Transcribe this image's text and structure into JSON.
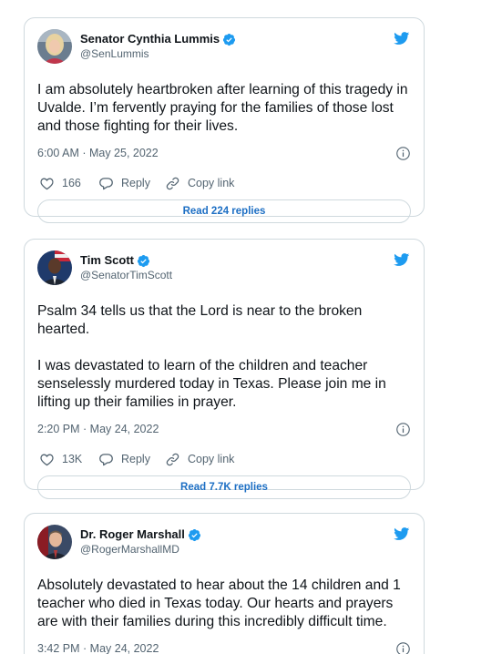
{
  "colors": {
    "twitter_blue": "#1d9bf0",
    "text": "#0f1419",
    "secondary": "#536471",
    "link": "#1d6fc4",
    "border": "#cfd9de"
  },
  "tweets": [
    {
      "name": "Senator Cynthia Lummis",
      "handle": "@SenLummis",
      "paragraphs": [
        "I am absolutely heartbroken after learning of this tragedy in Uvalde. I’m fervently praying for the families of those lost and those fighting for their lives."
      ],
      "timestamp": "6:00 AM · May 25, 2022",
      "likes": "166",
      "reply_label": "Reply",
      "copy_label": "Copy link",
      "replies_button": "Read 224 replies",
      "icons": [
        "verified-badge-icon",
        "twitter-bird-icon",
        "info-icon",
        "heart-icon",
        "reply-bubble-icon",
        "link-icon"
      ]
    },
    {
      "name": "Tim Scott",
      "handle": "@SenatorTimScott",
      "paragraphs": [
        "Psalm 34 tells us that the Lord is near to the broken hearted.",
        "I was devastated to learn of the children and teacher senselessly murdered today in Texas. Please join me in lifting up their families in prayer."
      ],
      "timestamp": "2:20 PM · May 24, 2022",
      "likes": "13K",
      "reply_label": "Reply",
      "copy_label": "Copy link",
      "replies_button": "Read 7.7K replies",
      "icons": [
        "verified-badge-icon",
        "twitter-bird-icon",
        "info-icon",
        "heart-icon",
        "reply-bubble-icon",
        "link-icon"
      ]
    },
    {
      "name": "Dr. Roger Marshall",
      "handle": "@RogerMarshallMD",
      "paragraphs": [
        "Absolutely devastated to hear about the 14 children and 1 teacher who died in Texas today. Our hearts and prayers are with their families during this incredibly difficult time."
      ],
      "timestamp": "3:42 PM · May 24, 2022",
      "icons": [
        "verified-badge-icon",
        "twitter-bird-icon",
        "info-icon"
      ]
    }
  ]
}
